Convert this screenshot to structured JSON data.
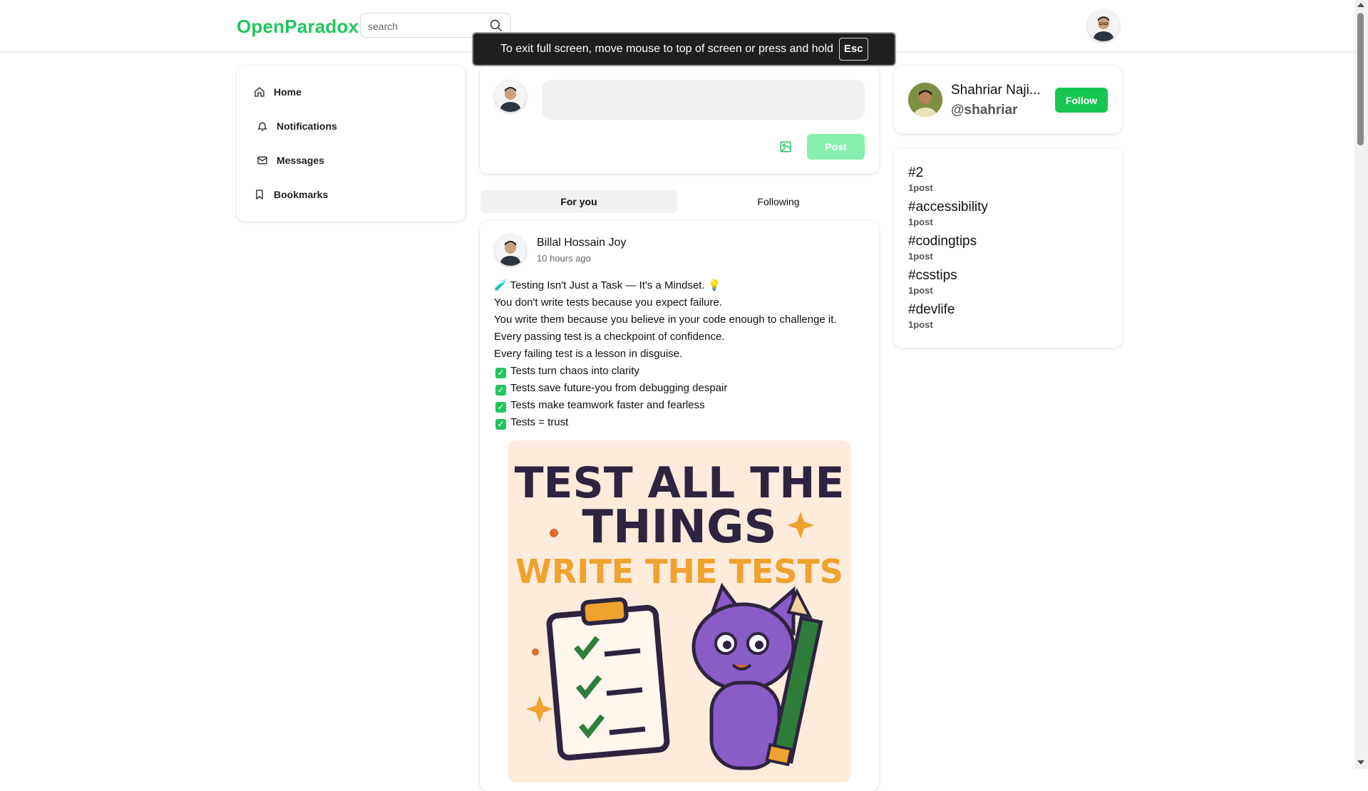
{
  "app": {
    "logo": "OpenParadox",
    "accent_color": "#22c55e"
  },
  "search": {
    "placeholder": "search"
  },
  "fullscreen_toast": {
    "message": "To exit full screen, move mouse to top of screen or press and hold",
    "key": "Esc"
  },
  "left_nav": {
    "items": [
      {
        "label": "Home",
        "icon": "home-icon"
      },
      {
        "label": "Notifications",
        "icon": "bell-icon"
      },
      {
        "label": "Messages",
        "icon": "mail-icon"
      },
      {
        "label": "Bookmarks",
        "icon": "bookmark-icon"
      }
    ]
  },
  "composer": {
    "textarea_value": "",
    "post_label": "Post",
    "image_icon": "image-icon"
  },
  "feed_tabs": [
    {
      "label": "For you",
      "active": true
    },
    {
      "label": "Following",
      "active": false
    }
  ],
  "post": {
    "author": "Billal Hossain Joy",
    "time": "10 hours ago",
    "lines": [
      "🧪 Testing Isn't Just a Task — It's a Mindset. 💡",
      "You don't write tests because you expect failure.",
      "You write them because you believe in your code enough to challenge it.",
      "Every passing test is a checkpoint of confidence.",
      "Every failing test is a lesson in disguise."
    ],
    "checklist": [
      "Tests turn chaos into clarity",
      "Tests save future-you from debugging despair",
      "Tests make teamwork faster and fearless",
      "Tests = trust"
    ],
    "image": {
      "headline_1": "TEST ALL THE",
      "headline_2": "THINGS",
      "headline_3": "WRITE THE TESTS"
    }
  },
  "who_to_follow": {
    "name": "Shahriar Naji...",
    "handle": "@shahriar",
    "follow_label": "Follow"
  },
  "trends": [
    {
      "tag": "#2",
      "count": "1post"
    },
    {
      "tag": "#accessibility",
      "count": "1post"
    },
    {
      "tag": "#codingtips",
      "count": "1post"
    },
    {
      "tag": "#csstips",
      "count": "1post"
    },
    {
      "tag": "#devlife",
      "count": "1post"
    }
  ]
}
